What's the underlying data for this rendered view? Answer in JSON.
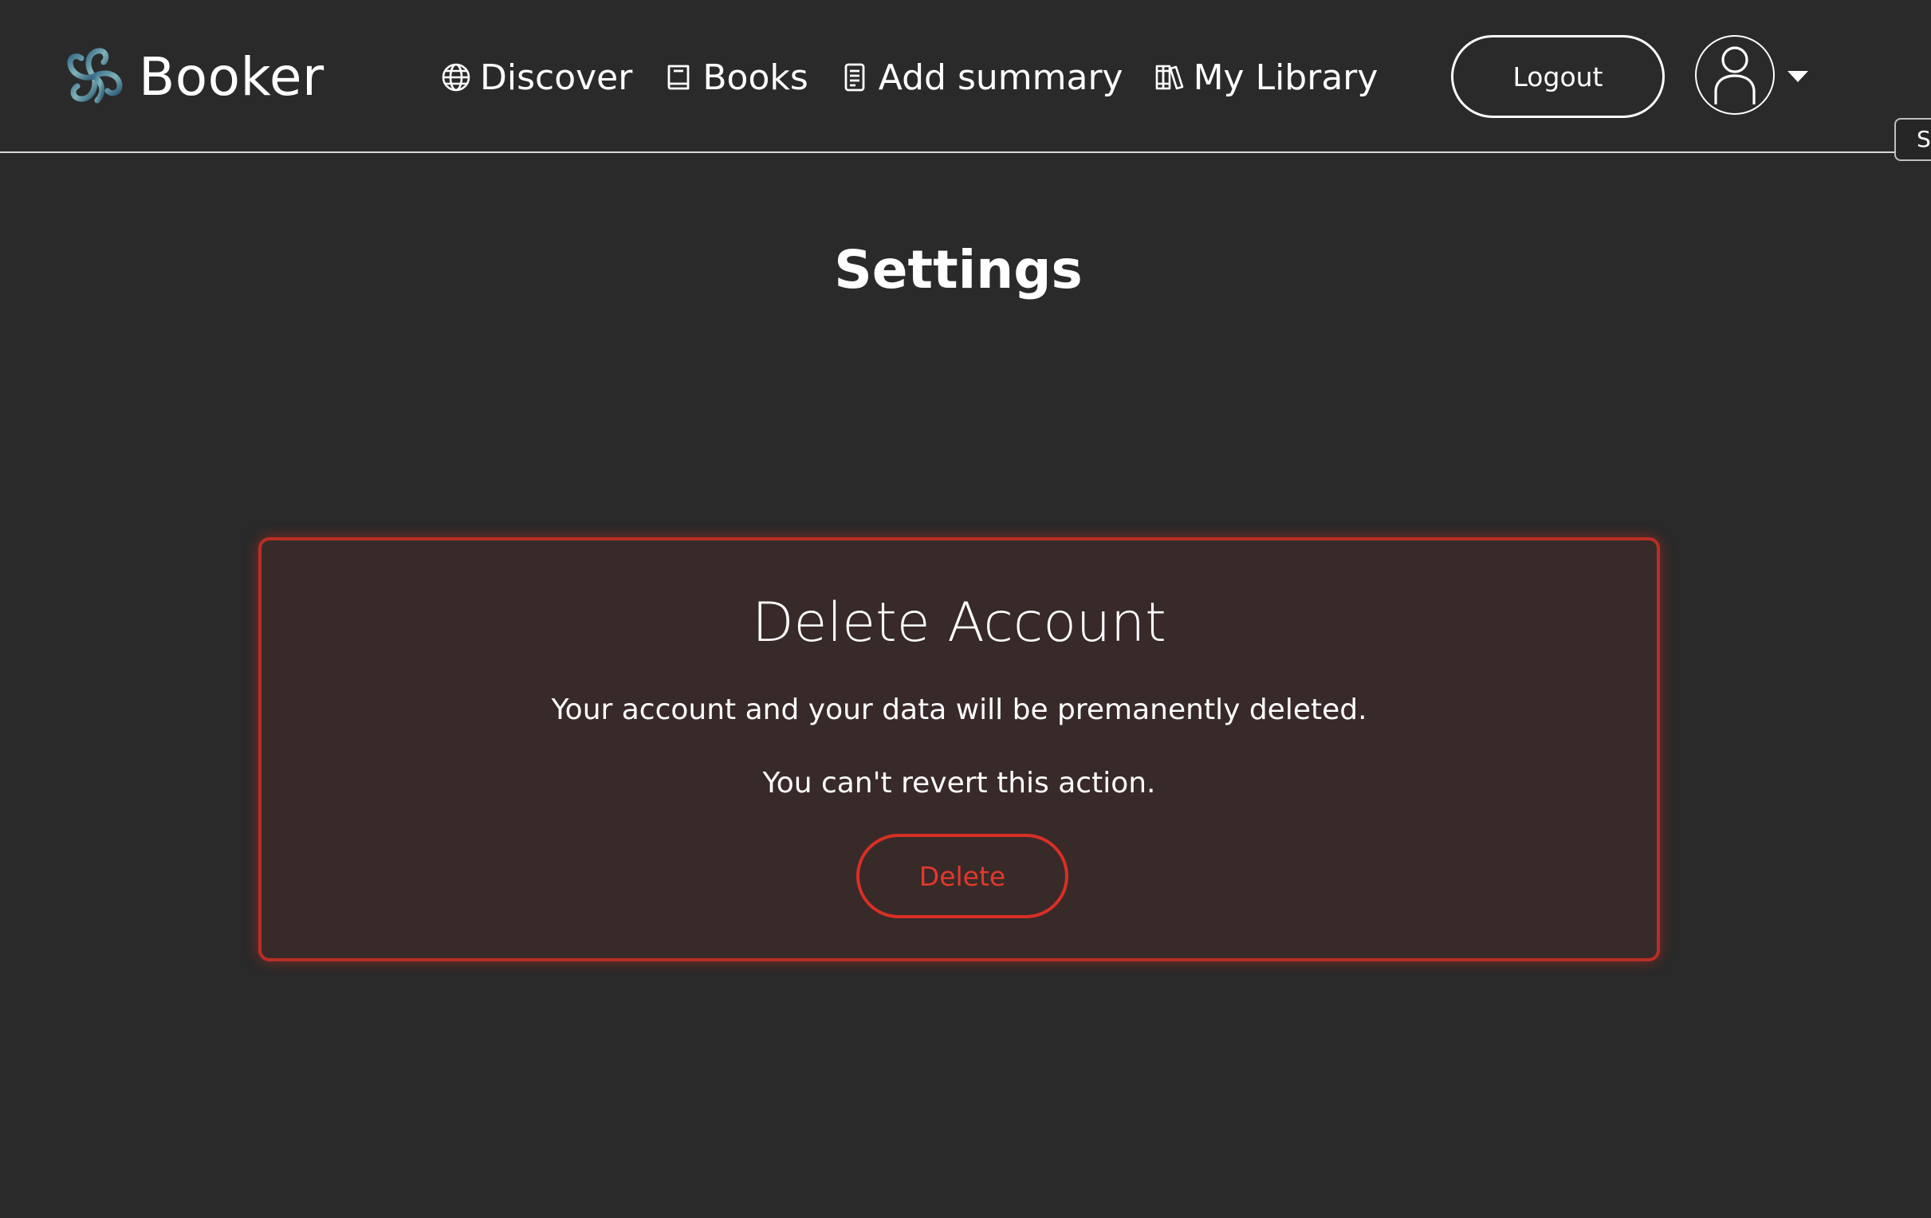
{
  "brand": {
    "name": "Booker",
    "logo_icon": "booker-flower-logo"
  },
  "nav": {
    "items": [
      {
        "label": "Discover",
        "icon": "globe-icon"
      },
      {
        "label": "Books",
        "icon": "book-icon"
      },
      {
        "label": "Add summary",
        "icon": "document-icon"
      },
      {
        "label": "My Library",
        "icon": "library-icon"
      }
    ]
  },
  "header": {
    "logout_label": "Logout",
    "avatar_icon": "user-icon",
    "dropdown_icon": "caret-down-icon",
    "side_tab_label": "S"
  },
  "main": {
    "title": "Settings",
    "danger_zone": {
      "title": "Delete Account",
      "line1": "Your account and your data will be premanently deleted.",
      "line2": "You can't revert this action.",
      "delete_label": "Delete"
    }
  },
  "colors": {
    "background": "#2a2a2a",
    "card_background": "#382a29",
    "danger": "#d83025",
    "text": "#ffffff"
  }
}
